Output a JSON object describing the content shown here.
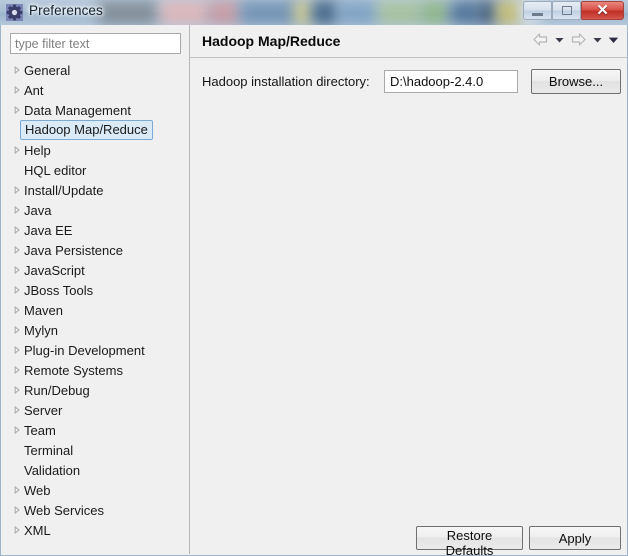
{
  "window": {
    "title": "Preferences",
    "icon": "gear-icon",
    "controls": {
      "minimize_label": "Minimize",
      "maximize_label": "Restore",
      "close_label": "✕"
    }
  },
  "sidebar": {
    "filter": {
      "placeholder": "type filter text",
      "value": ""
    },
    "items": [
      {
        "label": "General",
        "expandable": true,
        "selected": false
      },
      {
        "label": "Ant",
        "expandable": true,
        "selected": false
      },
      {
        "label": "Data Management",
        "expandable": true,
        "selected": false
      },
      {
        "label": "Hadoop Map/Reduce",
        "expandable": false,
        "selected": true
      },
      {
        "label": "Help",
        "expandable": true,
        "selected": false
      },
      {
        "label": "HQL editor",
        "expandable": false,
        "selected": false
      },
      {
        "label": "Install/Update",
        "expandable": true,
        "selected": false
      },
      {
        "label": "Java",
        "expandable": true,
        "selected": false
      },
      {
        "label": "Java EE",
        "expandable": true,
        "selected": false
      },
      {
        "label": "Java Persistence",
        "expandable": true,
        "selected": false
      },
      {
        "label": "JavaScript",
        "expandable": true,
        "selected": false
      },
      {
        "label": "JBoss Tools",
        "expandable": true,
        "selected": false
      },
      {
        "label": "Maven",
        "expandable": true,
        "selected": false
      },
      {
        "label": "Mylyn",
        "expandable": true,
        "selected": false
      },
      {
        "label": "Plug-in Development",
        "expandable": true,
        "selected": false
      },
      {
        "label": "Remote Systems",
        "expandable": true,
        "selected": false
      },
      {
        "label": "Run/Debug",
        "expandable": true,
        "selected": false
      },
      {
        "label": "Server",
        "expandable": true,
        "selected": false
      },
      {
        "label": "Team",
        "expandable": true,
        "selected": false
      },
      {
        "label": "Terminal",
        "expandable": false,
        "selected": false
      },
      {
        "label": "Validation",
        "expandable": false,
        "selected": false
      },
      {
        "label": "Web",
        "expandable": true,
        "selected": false
      },
      {
        "label": "Web Services",
        "expandable": true,
        "selected": false
      },
      {
        "label": "XML",
        "expandable": true,
        "selected": false
      }
    ]
  },
  "page": {
    "title": "Hadoop Map/Reduce",
    "nav": {
      "back_icon": "arrow-left-icon",
      "back_menu_icon": "caret-down-icon",
      "forward_icon": "arrow-right-icon",
      "forward_menu_icon": "caret-down-icon",
      "view_menu_icon": "caret-down-icon"
    },
    "setting": {
      "label": "Hadoop installation directory:",
      "value": "D:\\hadoop-2.4.0",
      "placeholder": "",
      "browse_label": "Browse..."
    }
  },
  "footer": {
    "restore_defaults_label": "Restore Defaults",
    "apply_label": "Apply"
  },
  "colors": {
    "selection_fill": "#dbeaf7",
    "selection_border": "#7ca8d6",
    "close_button": "#bf2f26",
    "titlebar": "#aabfd4",
    "panel_bg": "#f0f0f0"
  }
}
